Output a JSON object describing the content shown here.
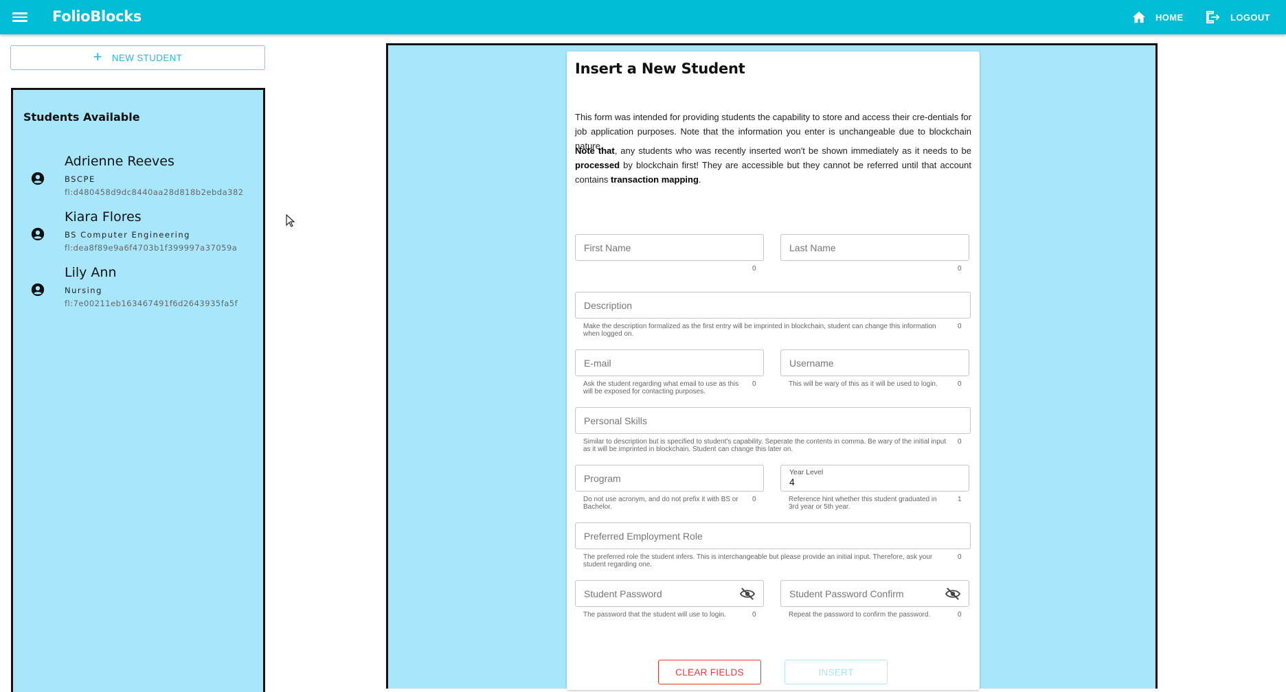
{
  "app": {
    "brand": "FolioBlocks"
  },
  "nav": {
    "home_label": "HOME",
    "logout_label": "LOGOUT"
  },
  "sidebar": {
    "new_student_label": "NEW STUDENT",
    "panel_title": "Students Available",
    "students": [
      {
        "name": "Adrienne Reeves",
        "program": "BSCPE",
        "id": "fl:d480458d9dc8440aa28d818b2ebda382"
      },
      {
        "name": "Kiara Flores",
        "program": "BS Computer Engineering",
        "id": "fl:dea8f89e9a6f4703b1f399997a37059a"
      },
      {
        "name": "Lily Ann",
        "program": "Nursing",
        "id": "fl:7e00211eb163467491f6d2643935fa5f"
      }
    ]
  },
  "form": {
    "title": "Insert a New Student",
    "intro": "This form was intended for providing students the capability to store and access their cre-dentials for job application purposes. Note that the information you enter is unchangeable due to blockchain nature.",
    "note": {
      "bold1": "Note that",
      "text1": ", any students who was recently inserted won't be shown immediately as it needs to be ",
      "bold2": "processed",
      "text2": " by blockchain first! They are accessible but they cannot be referred until that account contains ",
      "bold3": "transaction mapping",
      "text3": "."
    },
    "fields": {
      "first_name": {
        "placeholder": "First Name",
        "counter": "0"
      },
      "last_name": {
        "placeholder": "Last Name",
        "counter": "0"
      },
      "description": {
        "placeholder": "Description",
        "hint": "Make the description formalized as the first entry will be imprinted in blockchain, student can change this information when logged on.",
        "counter": "0"
      },
      "email": {
        "placeholder": "E-mail",
        "hint": "Ask the student regarding what email to use as this will be exposed for contacting purposes.",
        "counter": "0"
      },
      "username": {
        "placeholder": "Username",
        "hint": "This will be wary of this as it will be used to login.",
        "counter": "0"
      },
      "skills": {
        "placeholder": "Personal Skills",
        "hint": "Similar to description but is specified to student's capability. Seperate the contents in comma. Be wary of the initial input as it will be imprinted in blockchain. Student can change this later on.",
        "counter": "0"
      },
      "program": {
        "placeholder": "Program",
        "hint": "Do not use acronym, and do not prefix it with BS or Bachelor.",
        "counter": "0"
      },
      "year_level": {
        "label": "Year Level",
        "value": "4",
        "hint": "Reference hint whether this student graduated in 3rd year or 5th year.",
        "counter": "1"
      },
      "role": {
        "placeholder": "Preferred Employment Role",
        "hint": "The preferred role the student infers. This is interchangeable but please provide an initial input. Therefore, ask your student regarding one.",
        "counter": "0"
      },
      "password": {
        "placeholder": "Student Password",
        "hint": "The password that the student will use to login.",
        "counter": "0"
      },
      "password_confirm": {
        "placeholder": "Student Password Confirm",
        "hint": "Repeat the password to confirm the password.",
        "counter": "0"
      }
    },
    "buttons": {
      "clear": "CLEAR FIELDS",
      "insert": "INSERT"
    }
  },
  "colors": {
    "topbar": "#00bcd4",
    "panel": "#a8e7fb",
    "clear": "#e53935",
    "insert_disabled": "#a6e4f1"
  },
  "icons": [
    "menu-icon",
    "home-icon",
    "logout-icon",
    "plus-icon",
    "account-icon",
    "eye-off-icon",
    "cursor-icon"
  ]
}
